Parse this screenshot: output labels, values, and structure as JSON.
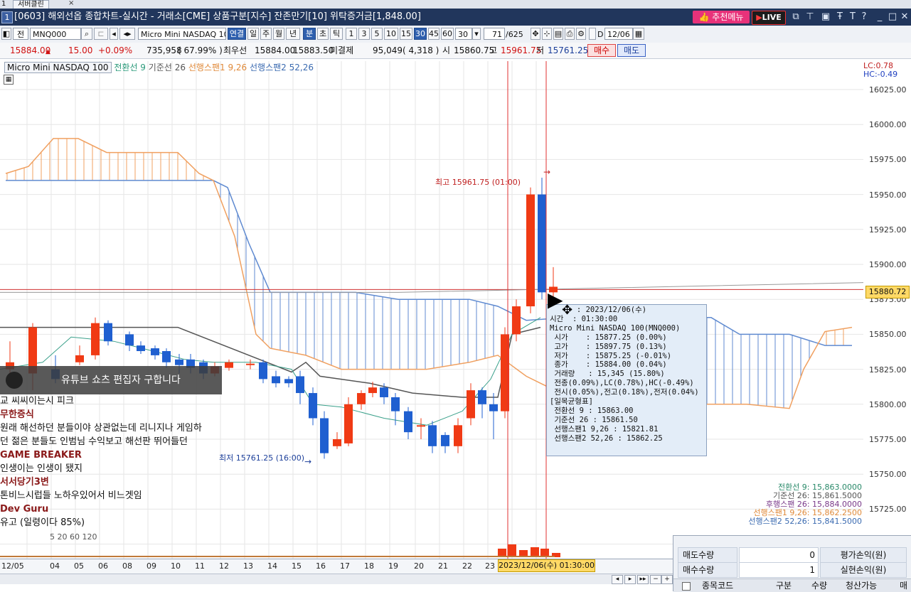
{
  "tabbar": {
    "index": "1",
    "tab_label": "서버클린",
    "close": "×"
  },
  "window": {
    "num": "1",
    "title": "[0603] 해외선옵 종합차트-실시간 - 거래소[CME] 상품구분[지수] 잔존만기[10] 위탁증거금[1,848.00]",
    "recommend_label": "추천메뉴",
    "live_label": "LIVE"
  },
  "toolbar": {
    "type_label": "전",
    "symbol_code": "MNQ000",
    "symbol_name": "Micro Mini NASDAQ 10",
    "period_buttons": [
      "연결",
      "일",
      "주",
      "월",
      "년",
      "분",
      "초",
      "틱"
    ],
    "minute_buttons": [
      "1",
      "3",
      "5",
      "10",
      "15",
      "30",
      "45",
      "60"
    ],
    "interval_value": "30",
    "count_value": "71",
    "count_total": "/625",
    "d_label": "D",
    "date_value": "12/06"
  },
  "quote": {
    "price": "15884.00",
    "change": "15.00",
    "change_pct": "+0.09%",
    "volume": "735,958",
    "volume_ratio": "( 67.99% )",
    "best_ask_label": "최우선",
    "best_ask": "15884.00",
    "best_bid": "15883.50",
    "open_interest_label": "미결제",
    "open_interest": "95,049",
    "oi_change": "( 4,318 )",
    "open_label": "시",
    "open": "15860.75",
    "high_label": "고",
    "high": "15961.75",
    "low_label": "저",
    "low": "15761.25",
    "sell_label": "매수",
    "buy_label": "매도"
  },
  "legend": {
    "symbol": "Micro Mini NASDAQ 100",
    "tenkan": "전환선 9",
    "kijun": "기준선 26",
    "senkou1": "선행스팬1 9,26",
    "senkou2": "선행스팬2 52,26"
  },
  "lc_hc": {
    "lc": "LC:0.78",
    "hc": "HC:-0.49"
  },
  "price_ticks": [
    "16025.00",
    "16000.00",
    "15975.00",
    "15950.00",
    "15925.00",
    "15900.00",
    "15875.00",
    "15850.00",
    "15825.00",
    "15800.00",
    "15775.00",
    "15750.00",
    "15725.00"
  ],
  "price_tag": "15880.72",
  "annotations": {
    "high": "최고 15961.75 (01:00)",
    "low": "최저 15761.25 (16:00)"
  },
  "dates": [
    "12/05",
    "04",
    "05",
    "06",
    "08",
    "09",
    "10",
    "11",
    "12",
    "13",
    "14",
    "15",
    "16",
    "17",
    "18",
    "19",
    "20",
    "21",
    "22",
    "23"
  ],
  "date_cursor": "2023/12/06(수) 01:30:00",
  "tooltip": [
    "      : 2023/12/06(수)",
    "시간  : 01:30:00",
    "Micro Mini NASDAQ 100(MNQ000)",
    " 시가    : 15877.25 (0.00%)",
    " 고가    : 15897.75 (0.13%)",
    " 저가    : 15875.25 (-0.01%)",
    " 종가    : 15884.00 (0.04%)",
    " 거래량   : 15,345 (15.80%)",
    " 전종(0.09%),LC(0.78%),HC(-0.49%)",
    " 전시(0.05%),전고(0.18%),전저(0.04%)",
    "[일목균형표]",
    " 전환선 9 : 15863.00",
    " 기준선 26 : 15861.50",
    " 선행스팬1 9,26 : 15821.81",
    " 선행스팬2 52,26 : 15862.25"
  ],
  "ichimoku_values": [
    {
      "label": "전환선 9: 15,863.0000",
      "color": "#2a8a6a"
    },
    {
      "label": "기준선 26: 15,861.5000",
      "color": "#555555"
    },
    {
      "label": "후행스팬 26: 15,884.0000",
      "color": "#7a3a8a"
    },
    {
      "label": "선행스팬1 9,26: 15,862.2500",
      "color": "#e08a3a"
    },
    {
      "label": "선행스팬2 52,26: 15,841.5000",
      "color": "#3a6ab0"
    }
  ],
  "overlay": {
    "youtube_banner": "유튜브 쇼츠 편집자 구합니다",
    "partial_line": "교 씨씨이는시 피크",
    "chat": [
      {
        "name": "무한증식",
        "msg": "원래 해선하던 분들이야 상관없는데 리니지나 게임하"
      },
      {
        "name": "",
        "msg": "던 젊은 분들도 인범님 수익보고 해선판 뛰어들던"
      },
      {
        "name": "GAME BREAKER",
        "msg": "인생이는 인생이 됐지"
      },
      {
        "name": "서서당기3변",
        "msg": "톤비느시럽들 노하우있어서 비느겟임"
      },
      {
        "name": "Dev Guru",
        "msg": "유고 (일령이다 85%)"
      }
    ],
    "volume_ma": "5  20  60  120"
  },
  "order_panel": {
    "rows": [
      {
        "label": "매도수량",
        "value": "0",
        "label2": "평가손익(원)"
      },
      {
        "label": "매수수량",
        "value": "1",
        "label2": "실현손익(원)"
      }
    ],
    "headers": [
      "종목코드",
      "구분",
      "수량",
      "청산가능",
      "매"
    ]
  },
  "colors": {
    "up": "#f03a14",
    "down": "#1f5fd0",
    "tenkan": "#3aa08a",
    "kijun": "#555555",
    "span1": "#f0a060",
    "span2": "#5f8ad0",
    "cursor": "#e03030"
  },
  "chart_data": {
    "type": "candlestick",
    "x": [
      "12/05",
      "04",
      "05",
      "06",
      "08",
      "09",
      "10",
      "11",
      "12",
      "13",
      "14",
      "15",
      "16",
      "17",
      "18",
      "19",
      "20",
      "21",
      "22",
      "23",
      "2023/12/06(수) 01:30:00"
    ],
    "ylim": [
      15700,
      16035
    ],
    "series": [
      {
        "name": "전환선 9",
        "values_shown": "tenkan line"
      },
      {
        "name": "기준선 26",
        "values_shown": "kijun line"
      },
      {
        "name": "선행스팬1 9,26",
        "values_shown": "span1"
      },
      {
        "name": "선행스팬2 52,26",
        "values_shown": "span2"
      }
    ],
    "high": 15961.75,
    "low": 15761.25,
    "last": 15884.0
  }
}
